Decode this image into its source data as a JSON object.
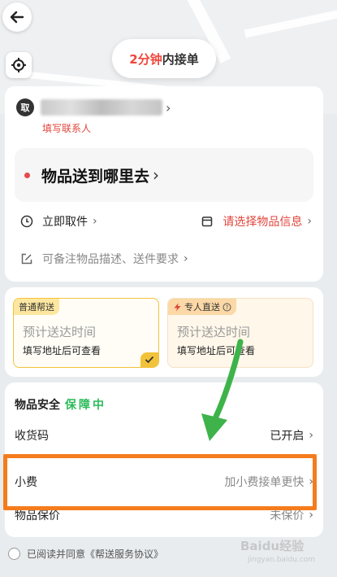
{
  "map": {
    "eta_prefix": "2分钟",
    "eta_suffix": "内接单"
  },
  "pickup": {
    "badge": "取",
    "contact_link": "填写联系人"
  },
  "destination": {
    "label": "物品送到哪里去"
  },
  "options": {
    "pickup_time": "立即取件",
    "item_info": "请选择物品信息",
    "note": "可备注物品描述、送件要求"
  },
  "services": [
    {
      "tag": "普通帮送",
      "eta": "预计送达时间",
      "note": "填写地址后可查看",
      "selected": true
    },
    {
      "tag": "专人直送",
      "eta": "预计送达时间",
      "note": "填写地址后可查看",
      "selected": false
    }
  ],
  "safety": {
    "title": "物品安全",
    "badge": "保障中",
    "rows": [
      {
        "label": "收货码",
        "value": "已开启"
      },
      {
        "label": "小费",
        "value": "加小费接单更快"
      },
      {
        "label": "物品保价",
        "value": "未保价"
      }
    ]
  },
  "agreement": {
    "text": "已阅读并同意《帮送服务协议》"
  },
  "watermark": {
    "brand": "Baidu经验",
    "url": "jingyan.baidu.com"
  },
  "colors": {
    "accent_red": "#e0463c",
    "green": "#2bbb5a",
    "highlight_orange": "#f57c1c",
    "arrow_green": "#3db34a",
    "selected_yellow": "#f2c23a"
  }
}
